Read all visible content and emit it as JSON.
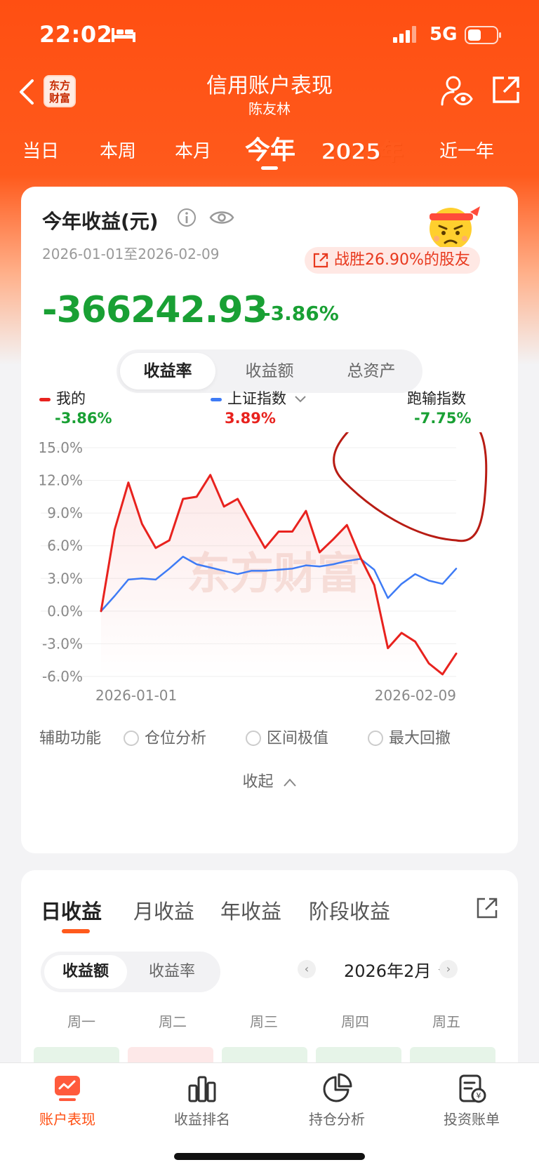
{
  "status": {
    "time": "22:02",
    "network": "5G"
  },
  "nav": {
    "title": "信用账户表现",
    "subtitle": "陈友林",
    "logo_text": "东方财富"
  },
  "period_tabs": [
    {
      "label": "当日",
      "active": false
    },
    {
      "label": "本周",
      "active": false
    },
    {
      "label": "本月",
      "active": false
    },
    {
      "label": "今年",
      "active": true
    },
    {
      "label": "2025年",
      "active": false
    },
    {
      "label": "近一年",
      "active": false
    }
  ],
  "summary": {
    "title": "今年收益(元)",
    "date_range": "2026-01-01至2026-02-09",
    "beat_text": "战胜26.90%的股友",
    "value": "-366242.93",
    "percent": "-3.86%"
  },
  "metric_toggle": {
    "options": [
      "收益率",
      "收益额",
      "总资产"
    ],
    "selected": "收益率"
  },
  "legend": {
    "mine": {
      "label": "我的",
      "value": "-3.86%"
    },
    "index": {
      "label": "上证指数",
      "value": "3.89%"
    },
    "gap": {
      "label": "跑输指数",
      "value": "-7.75%"
    }
  },
  "chart_data": {
    "type": "line",
    "y_ticks": [
      "15.0%",
      "12.0%",
      "9.0%",
      "6.0%",
      "3.0%",
      "0.0%",
      "-3.0%",
      "-6.0%"
    ],
    "ylim": [
      -6,
      15
    ],
    "x_labels": [
      "2026-01-01",
      "2026-02-09"
    ],
    "watermark": "东方财富",
    "series": [
      {
        "name": "我的",
        "color": "#e8221e",
        "values": [
          0.0,
          7.5,
          11.8,
          8.0,
          5.8,
          6.5,
          10.3,
          10.5,
          12.5,
          9.6,
          10.3,
          8.0,
          5.8,
          7.3,
          7.3,
          9.2,
          5.4,
          6.6,
          7.9,
          4.9,
          2.4,
          -3.4,
          -2.0,
          -2.8,
          -4.8,
          -5.8,
          -3.9
        ]
      },
      {
        "name": "上证指数",
        "color": "#3e7bf5",
        "values": [
          0.0,
          1.4,
          2.9,
          3.0,
          2.9,
          3.9,
          5.0,
          4.3,
          4.0,
          3.7,
          3.4,
          3.7,
          3.7,
          3.8,
          3.9,
          4.2,
          4.1,
          4.3,
          4.6,
          4.8,
          3.8,
          1.2,
          2.5,
          3.4,
          2.8,
          2.5,
          3.9
        ]
      }
    ]
  },
  "aux": {
    "label": "辅助功能",
    "options": [
      "仓位分析",
      "区间极值",
      "最大回撤"
    ],
    "collapse": "收起"
  },
  "daily": {
    "tabs": [
      "日收益",
      "月收益",
      "年收益",
      "阶段收益"
    ],
    "toggle": [
      "收益额",
      "收益率"
    ],
    "month": "2026年2月",
    "weekdays": [
      "周一",
      "周二",
      "周三",
      "周四",
      "周五"
    ],
    "cell_colors": [
      "#e6f4e8",
      "#fde8e8",
      "#e6f4e8",
      "#e6f4e8",
      "#e6f4e8"
    ]
  },
  "bottom_nav": [
    {
      "label": "账户表现",
      "active": true
    },
    {
      "label": "收益排名",
      "active": false
    },
    {
      "label": "持仓分析",
      "active": false
    },
    {
      "label": "投资账单",
      "active": false
    }
  ]
}
